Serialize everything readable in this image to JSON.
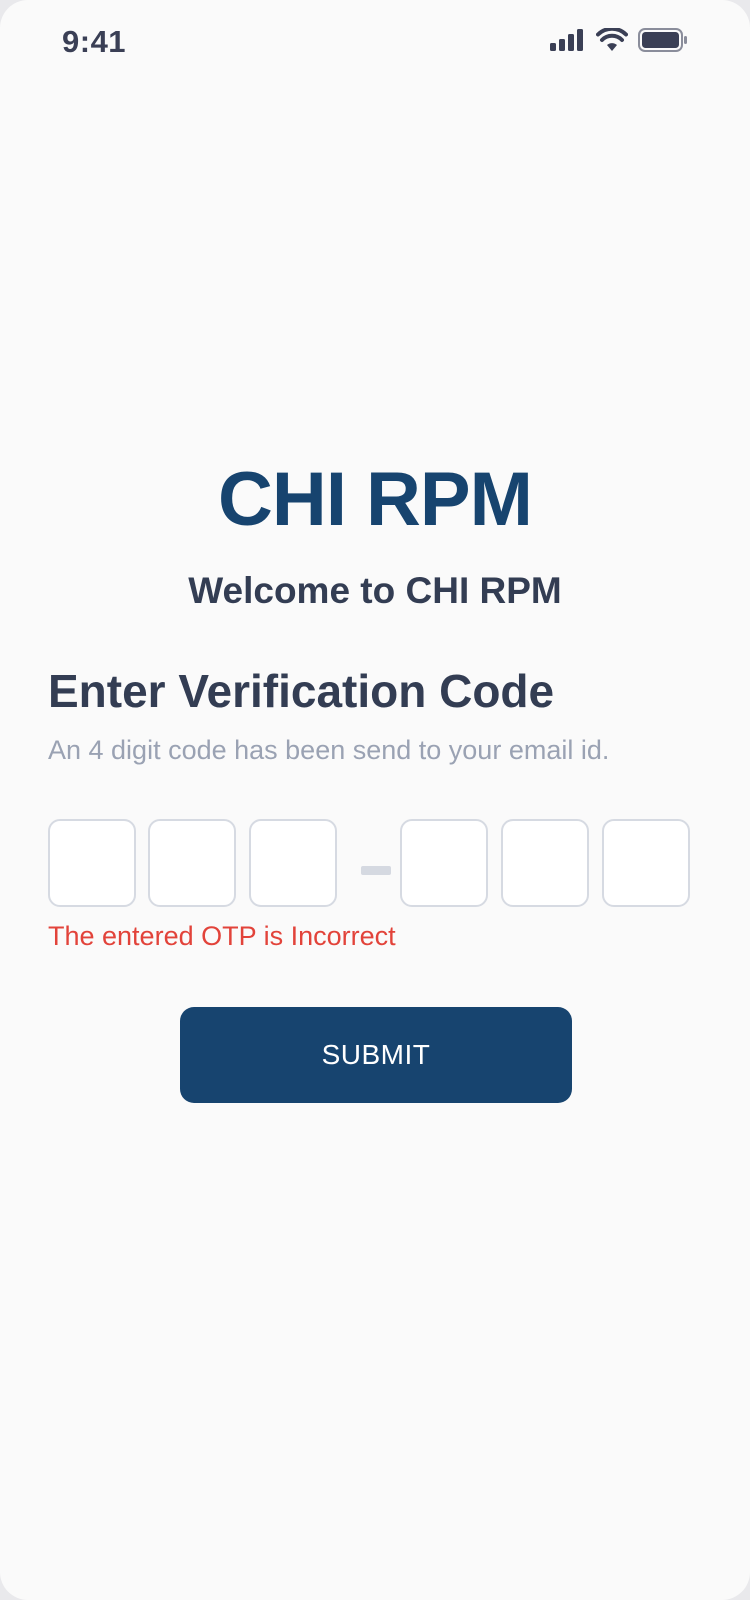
{
  "status_bar": {
    "time": "9:41",
    "icons": [
      "signal-icon",
      "wifi-icon",
      "battery-icon"
    ]
  },
  "brand": {
    "logo_text": "CHI RPM",
    "welcome": "Welcome to CHI RPM"
  },
  "verification": {
    "heading": "Enter Verification Code",
    "subtext": "An 4 digit code has been send to your email id.",
    "otp_values": [
      "",
      "",
      "",
      "",
      "",
      ""
    ],
    "separator": "-",
    "error_message": "The entered OTP is Incorrect"
  },
  "actions": {
    "submit_label": "SUBMIT"
  },
  "colors": {
    "brand": "#17446f",
    "heading": "#333d53",
    "muted": "#9aa2b3",
    "error": "#e2433a",
    "background": "#fafafa",
    "input_border": "#d6dae2"
  }
}
